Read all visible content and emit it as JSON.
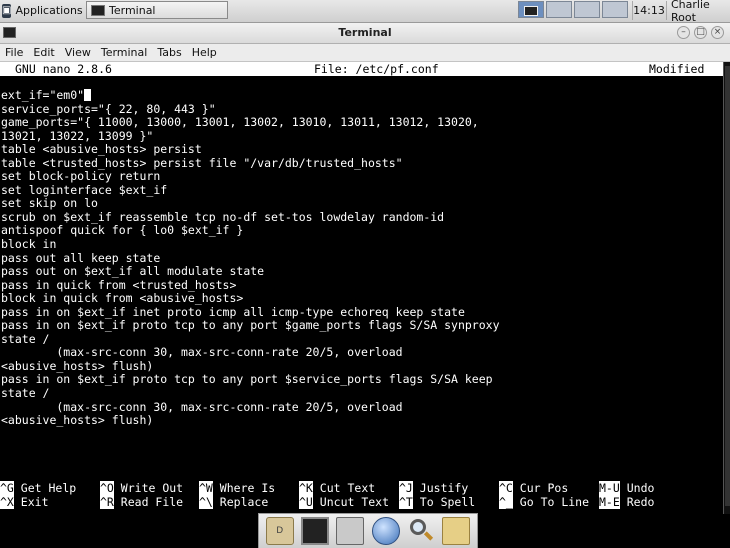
{
  "top_panel": {
    "applications_label": "Applications",
    "task_label": "Terminal",
    "clock": "14:13",
    "user": "Charlie Root"
  },
  "window": {
    "title": "Terminal"
  },
  "menubar": {
    "items": [
      "File",
      "Edit",
      "View",
      "Terminal",
      "Tabs",
      "Help"
    ]
  },
  "nano": {
    "version": "GNU nano 2.8.6",
    "file": "File: /etc/pf.conf",
    "status": "Modified",
    "lines": [
      "ext_if=\"em0\"",
      "service_ports=\"{ 22, 80, 443 }\"",
      "game_ports=\"{ 11000, 13000, 13001, 13002, 13010, 13011, 13012, 13020,",
      "13021, 13022, 13099 }\"",
      "table <abusive_hosts> persist",
      "table <trusted_hosts> persist file \"/var/db/trusted_hosts\"",
      "set block-policy return",
      "set loginterface $ext_if",
      "set skip on lo",
      "scrub on $ext_if reassemble tcp no-df set-tos lowdelay random-id",
      "antispoof quick for { lo0 $ext_if }",
      "block in",
      "pass out all keep state",
      "pass out on $ext_if all modulate state",
      "pass in quick from <trusted_hosts>",
      "block in quick from <abusive_hosts>",
      "pass in on $ext_if inet proto icmp all icmp-type echoreq keep state",
      "pass in on $ext_if proto tcp to any port $game_ports flags S/SA synproxy",
      "state /",
      "        (max-src-conn 30, max-src-conn-rate 20/5, overload",
      "<abusive_hosts> flush)",
      "pass in on $ext_if proto tcp to any port $service_ports flags S/SA keep",
      "state /",
      "        (max-src-conn 30, max-src-conn-rate 20/5, overload",
      "<abusive_hosts> flush)"
    ],
    "shortcuts_row1": [
      {
        "key": "^G",
        "label": "Get Help"
      },
      {
        "key": "^O",
        "label": "Write Out"
      },
      {
        "key": "^W",
        "label": "Where Is"
      },
      {
        "key": "^K",
        "label": "Cut Text"
      },
      {
        "key": "^J",
        "label": "Justify"
      },
      {
        "key": "^C",
        "label": "Cur Pos"
      },
      {
        "key": "M-U",
        "label": "Undo"
      }
    ],
    "shortcuts_row2": [
      {
        "key": "^X",
        "label": "Exit"
      },
      {
        "key": "^R",
        "label": "Read File"
      },
      {
        "key": "^\\",
        "label": "Replace"
      },
      {
        "key": "^U",
        "label": "Uncut Text"
      },
      {
        "key": "^T",
        "label": "To Spell"
      },
      {
        "key": "^_",
        "label": "Go To Line"
      },
      {
        "key": "M-E",
        "label": "Redo"
      }
    ]
  },
  "dock": {
    "items": [
      "home-folder-icon",
      "terminal-icon",
      "file-cabinet-icon",
      "web-browser-icon",
      "search-icon",
      "folder-icon"
    ]
  }
}
